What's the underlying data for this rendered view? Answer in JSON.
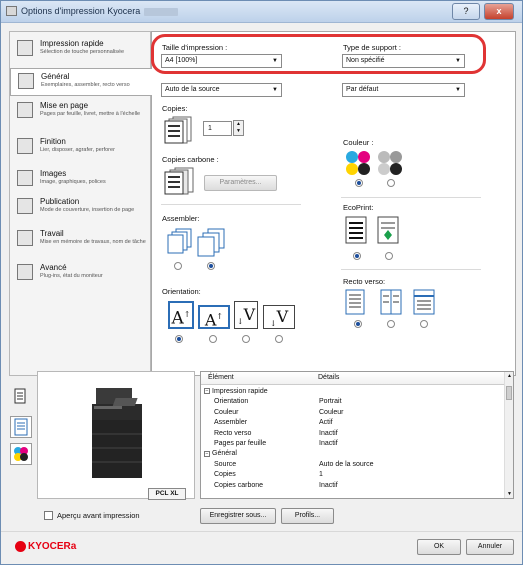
{
  "window": {
    "title": "Options d'impression Kyocera",
    "help_label": "?",
    "close_label": "x"
  },
  "sidebar": {
    "items": [
      {
        "label": "Impression rapide",
        "sub": "Sélection de touche personnalisée"
      },
      {
        "label": "Général",
        "sub": "Exemplaires, assembler, recto verso"
      },
      {
        "label": "Mise en page",
        "sub": "Pages par feuille, livret, mettre à l'échelle"
      },
      {
        "label": "Finition",
        "sub": "Lier, disposer, agrafer, perforer"
      },
      {
        "label": "Images",
        "sub": "Image, graphiques, polices"
      },
      {
        "label": "Publication",
        "sub": "Mode de couverture, insertion de page"
      },
      {
        "label": "Travail",
        "sub": "Mise en mémoire de travaux, nom de tâche"
      },
      {
        "label": "Avancé",
        "sub": "Plug-ins, état du moniteur"
      }
    ],
    "selected": "Général"
  },
  "general": {
    "print_size_label": "Taille d'impression :",
    "print_size_value": "A4 [100%]",
    "media_type_label": "Type de support :",
    "media_type_value": "Non spécifié",
    "source_value": "Auto de la source",
    "destination_value": "Par défaut",
    "copies_label": "Copies:",
    "copies_value": "1",
    "carbon_label": "Copies carbone :",
    "settings_button": "Paramètres...",
    "color_label": "Couleur :",
    "ecoprint_label": "EcoPrint:",
    "collate_label": "Assembler:",
    "orientation_label": "Orientation:",
    "duplex_label": "Recto verso:",
    "orientation_glyphs": [
      "A",
      "A",
      "V",
      "V"
    ]
  },
  "table": {
    "headers": [
      "Élément",
      "Détails"
    ],
    "rows": [
      {
        "item": "Impression rapide",
        "details": "",
        "level": 0,
        "toggle": "−"
      },
      {
        "item": "Orientation",
        "details": "Portrait",
        "level": 1
      },
      {
        "item": "Couleur",
        "details": "Couleur",
        "level": 1
      },
      {
        "item": "Assembler",
        "details": "Actif",
        "level": 1
      },
      {
        "item": "Recto verso",
        "details": "Inactif",
        "level": 1
      },
      {
        "item": "Pages par feuille",
        "details": "Inactif",
        "level": 1
      },
      {
        "item": "Général",
        "details": "",
        "level": 0,
        "toggle": "−"
      },
      {
        "item": "Source",
        "details": "Auto de la source",
        "level": 1
      },
      {
        "item": "Copies",
        "details": "1",
        "level": 1
      },
      {
        "item": "Copies carbone",
        "details": "Inactif",
        "level": 1
      }
    ]
  },
  "preview": {
    "badge": "PCL XL"
  },
  "bottom": {
    "preview_checkbox_label": "Aperçu avant impression",
    "save_button": "Enregistrer sous...",
    "profiles_button": "Profils..."
  },
  "footer": {
    "brand": "KYOCERa",
    "ok_button": "OK",
    "cancel_button": "Annuler"
  },
  "colors": {
    "highlight": "#e03434",
    "brand": "#e60012",
    "radio_on": "#1c4e9c"
  }
}
